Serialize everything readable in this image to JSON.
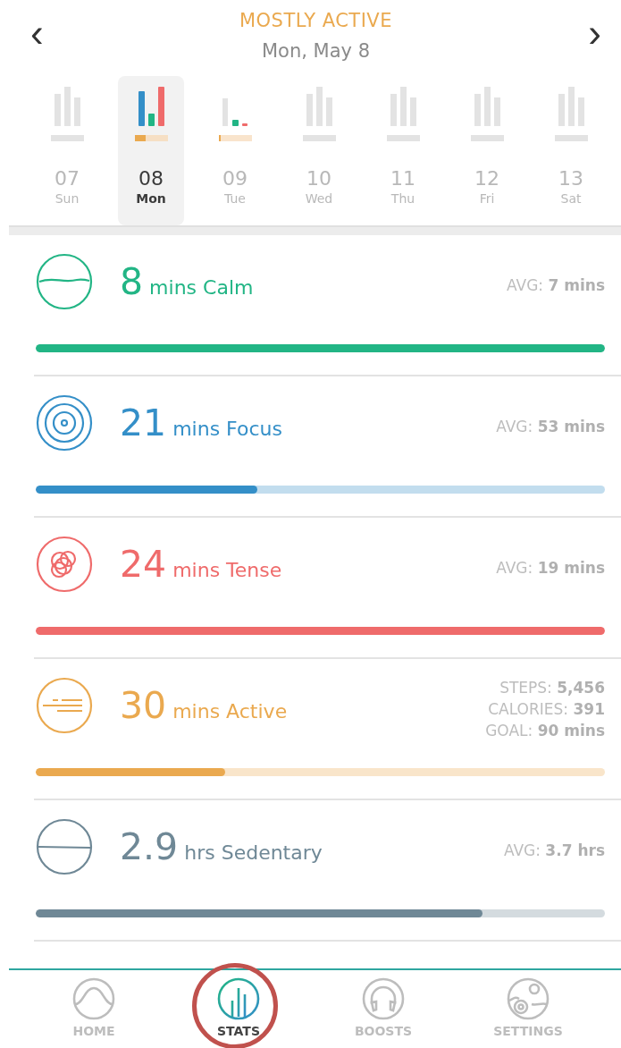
{
  "header": {
    "title": "MOSTLY ACTIVE",
    "date": "Mon, May 8",
    "prev": "‹",
    "next": "›"
  },
  "days": [
    {
      "number": "07",
      "name": "Sun",
      "selected": false,
      "kind": "none"
    },
    {
      "number": "08",
      "name": "Mon",
      "selected": true,
      "kind": "full"
    },
    {
      "number": "09",
      "name": "Tue",
      "selected": false,
      "kind": "partial"
    },
    {
      "number": "10",
      "name": "Wed",
      "selected": false,
      "kind": "none"
    },
    {
      "number": "11",
      "name": "Thu",
      "selected": false,
      "kind": "none"
    },
    {
      "number": "12",
      "name": "Fri",
      "selected": false,
      "kind": "none"
    },
    {
      "number": "13",
      "name": "Sat",
      "selected": false,
      "kind": "none"
    }
  ],
  "metrics": [
    {
      "kind": "calm",
      "value": "8",
      "unit": "mins Calm",
      "color": "#22b585",
      "level": 1,
      "stats": [
        "AVG: **7 mins**"
      ]
    },
    {
      "kind": "focus",
      "value": "21",
      "unit": "mins Focus",
      "color": "#348fc8",
      "level": 0.39,
      "stats": [
        "AVG: **53 mins**"
      ]
    },
    {
      "kind": "tense",
      "value": "24",
      "unit": "mins Tense",
      "color": "#ef6b6b",
      "level": 1,
      "stats": [
        "AVG: **19 mins**"
      ]
    },
    {
      "kind": "active",
      "value": "30",
      "unit": "mins Active",
      "color": "#eaa94f",
      "level": 0.333,
      "stats": [
        "STEPS: **5,456**",
        "CALORIES: **391**",
        "GOAL: **90 mins**"
      ]
    },
    {
      "kind": "sedentary",
      "value": "2.9",
      "unit": "hrs Sedentary",
      "color": "#6f8896",
      "level": 0.785,
      "stats": [
        "AVG: **3.7 hrs**"
      ]
    }
  ],
  "nav": [
    {
      "kind": "home",
      "label": "HOME",
      "selected": false,
      "highlighted": false
    },
    {
      "kind": "stats",
      "label": "STATS",
      "selected": true,
      "highlighted": true
    },
    {
      "kind": "boosts",
      "label": "BOOSTS",
      "selected": false,
      "highlighted": false
    },
    {
      "kind": "settings",
      "label": "SETTINGS",
      "selected": false,
      "highlighted": false
    }
  ]
}
